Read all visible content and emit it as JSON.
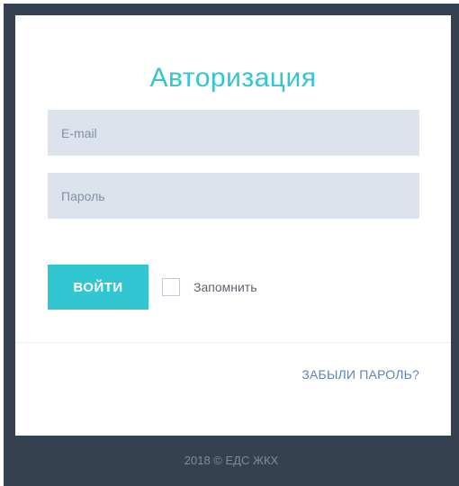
{
  "login": {
    "title": "Авторизация",
    "email_placeholder": "E-mail",
    "password_placeholder": "Пароль",
    "submit_label": "ВОЙТИ",
    "remember_label": "Запомнить",
    "forgot_label": "ЗАБЫЛИ ПАРОЛЬ?"
  },
  "footer": {
    "text": "2018 © ЕДС ЖКХ"
  },
  "colors": {
    "accent": "#32c5d2",
    "frame": "#364150",
    "input_bg": "#dde3ec",
    "link": "#5e84b8"
  }
}
